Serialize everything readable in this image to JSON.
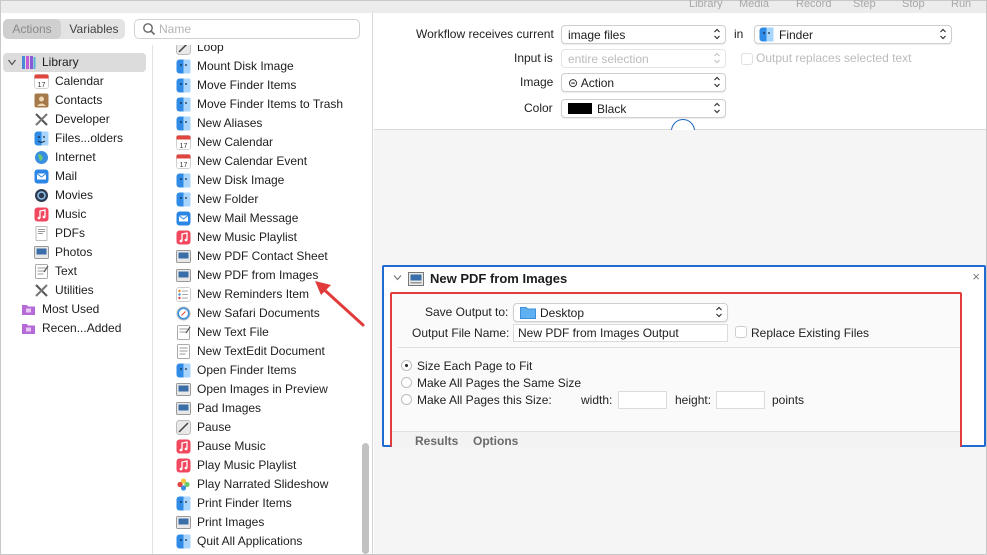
{
  "toolbar": {
    "items": [
      "Library",
      "Media",
      "Record",
      "Step",
      "Stop",
      "Run"
    ]
  },
  "left": {
    "tabs": {
      "actions": "Actions",
      "variables": "Variables"
    },
    "search_placeholder": "Name",
    "library": {
      "root": "Library",
      "items": [
        "Calendar",
        "Contacts",
        "Developer",
        "Files...olders",
        "Internet",
        "Mail",
        "Movies",
        "Music",
        "PDFs",
        "Photos",
        "Text",
        "Utilities"
      ],
      "extras": [
        "Most Used",
        "Recen...Added"
      ]
    },
    "actions": [
      "Loop",
      "Mount Disk Image",
      "Move Finder Items",
      "Move Finder Items to Trash",
      "New Aliases",
      "New Calendar",
      "New Calendar Event",
      "New Disk Image",
      "New Folder",
      "New Mail Message",
      "New Music Playlist",
      "New PDF Contact Sheet",
      "New PDF from Images",
      "New Reminders Item",
      "New Safari Documents",
      "New Text File",
      "New TextEdit Document",
      "Open Finder Items",
      "Open Images in Preview",
      "Pad Images",
      "Pause",
      "Pause Music",
      "Play Music Playlist",
      "Play Narrated Slideshow",
      "Print Finder Items",
      "Print Images",
      "Quit All Applications"
    ]
  },
  "workflow": {
    "receives_label": "Workflow receives current",
    "receives_value": "image files",
    "in_label": "in",
    "in_value": "Finder",
    "input_is_label": "Input is",
    "input_is_value": "entire selection",
    "output_replaces_label": "Output replaces selected text",
    "image_label": "Image",
    "image_value": "⊝ Action",
    "color_label": "Color",
    "color_value": "Black",
    "color_swatch": "#000000"
  },
  "action": {
    "title": "New PDF from Images",
    "save_output_label": "Save Output to:",
    "save_output_value": "Desktop",
    "output_name_label": "Output File Name:",
    "output_name_value": "New PDF from Images Output",
    "replace_label": "Replace Existing Files",
    "option1": "Size Each Page to Fit",
    "option2": "Make All Pages the Same Size",
    "option3": "Make All Pages this Size:",
    "width_label": "width:",
    "height_label": "height:",
    "points_label": "points",
    "footer_results": "Results",
    "footer_options": "Options",
    "close_glyph": "×"
  },
  "colors": {
    "accent": "#1f6bd1",
    "highlight": "#e23b3b"
  }
}
